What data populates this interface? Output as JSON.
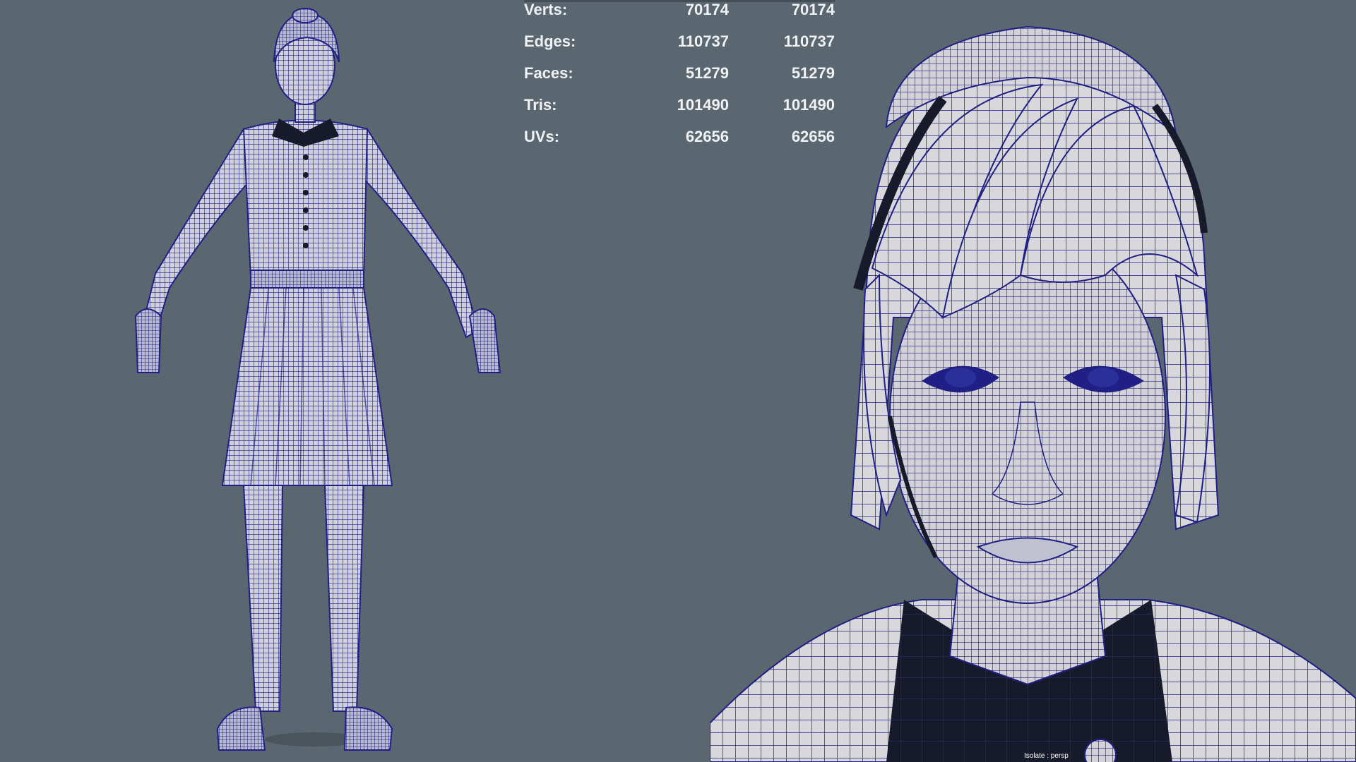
{
  "stats": {
    "rows": [
      {
        "label": "Verts:",
        "v1": "70174",
        "v2": "70174"
      },
      {
        "label": "Edges:",
        "v1": "110737",
        "v2": "110737"
      },
      {
        "label": "Faces:",
        "v1": "51279",
        "v2": "51279"
      },
      {
        "label": "Tris:",
        "v1": "101490",
        "v2": "101490"
      },
      {
        "label": "UVs:",
        "v1": "62656",
        "v2": "62656"
      }
    ]
  },
  "viewport": {
    "camera_label": "Isolate : persp"
  },
  "colors": {
    "background": "#5b6770",
    "wire": "#1f1f86",
    "surface": "#d8d8dc",
    "collar": "#161a2b"
  }
}
